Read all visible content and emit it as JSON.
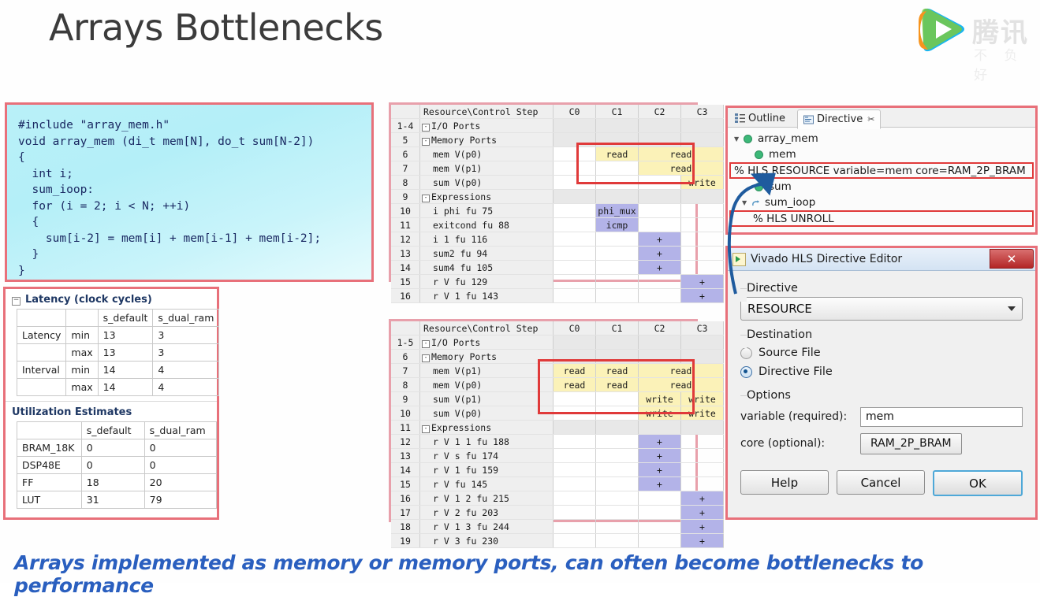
{
  "slide": {
    "title": "Arrays Bottlenecks",
    "caption": "Arrays implemented as memory or memory ports, can often become bottlenecks to performance",
    "logo": {
      "brand": "腾讯",
      "tagline": "不 负 好"
    }
  },
  "code": {
    "text": "#include \"array_mem.h\"\nvoid array_mem (di_t mem[N], do_t sum[N-2])\n{\n  int i;\n  sum_ioop:\n  for (i = 2; i < N; ++i)\n  {\n    sum[i-2] = mem[i] + mem[i-1] + mem[i-2];\n  }\n}"
  },
  "latency": {
    "header": "Latency (clock cycles)",
    "columns": [
      "",
      "",
      "s_default",
      "s_dual_ram"
    ],
    "rows": [
      [
        "Latency",
        "min",
        "13",
        "3"
      ],
      [
        "",
        "max",
        "13",
        "3"
      ],
      [
        "Interval",
        "min",
        "14",
        "4"
      ],
      [
        "",
        "max",
        "14",
        "4"
      ]
    ]
  },
  "utilization": {
    "header": "Utilization Estimates",
    "columns": [
      "",
      "s_default",
      "s_dual_ram"
    ],
    "rows": [
      [
        "BRAM_18K",
        "0",
        "0"
      ],
      [
        "DSP48E",
        "0",
        "0"
      ],
      [
        "FF",
        "18",
        "20"
      ],
      [
        "LUT",
        "31",
        "79"
      ]
    ]
  },
  "schedule1": {
    "header": [
      "",
      "Resource\\Control Step",
      "C0",
      "C1",
      "C2",
      "C3"
    ],
    "rows": [
      {
        "num": "1-4",
        "res": "I/O Ports",
        "group": true,
        "expander": true,
        "cells": [
          "",
          "",
          "",
          ""
        ]
      },
      {
        "num": "5",
        "res": "Memory Ports",
        "group": true,
        "expander": true,
        "cells": [
          "",
          "",
          "",
          ""
        ]
      },
      {
        "num": "6",
        "res": "mem V(p0)",
        "indent": true,
        "cells": [
          "",
          "read",
          "read",
          "read"
        ],
        "fill": [
          "",
          "yel",
          "yel",
          "yel"
        ],
        "span": [
          0,
          0,
          2,
          0
        ]
      },
      {
        "num": "7",
        "res": "mem V(p1)",
        "indent": true,
        "cells": [
          "",
          "",
          "read",
          "read"
        ],
        "fill": [
          "",
          "wht",
          "yel",
          "yel"
        ],
        "span": [
          0,
          0,
          2,
          0
        ]
      },
      {
        "num": "8",
        "res": "sum V(p0)",
        "indent": true,
        "cells": [
          "",
          "",
          "",
          "write"
        ],
        "fill": [
          "",
          "wht",
          "wht",
          "yel"
        ]
      },
      {
        "num": "9",
        "res": "Expressions",
        "group": true,
        "expander": true,
        "cells": [
          "",
          "",
          "",
          ""
        ]
      },
      {
        "num": "10",
        "res": "i phi fu 75",
        "indent": true,
        "cells": [
          "",
          "phi_mux",
          "",
          ""
        ],
        "fill": [
          "",
          "pur",
          "",
          ""
        ]
      },
      {
        "num": "11",
        "res": "exitcond fu 88",
        "indent": true,
        "cells": [
          "",
          "icmp",
          "",
          ""
        ],
        "fill": [
          "",
          "pur",
          "",
          ""
        ]
      },
      {
        "num": "12",
        "res": "i 1 fu 116",
        "indent": true,
        "cells": [
          "",
          "",
          "+",
          ""
        ],
        "fill": [
          "",
          "",
          "pur",
          ""
        ]
      },
      {
        "num": "13",
        "res": "sum2 fu 94",
        "indent": true,
        "cells": [
          "",
          "",
          "+",
          ""
        ],
        "fill": [
          "",
          "",
          "pur",
          ""
        ]
      },
      {
        "num": "14",
        "res": "sum4 fu 105",
        "indent": true,
        "cells": [
          "",
          "",
          "+",
          ""
        ],
        "fill": [
          "",
          "",
          "pur",
          ""
        ]
      },
      {
        "num": "15",
        "res": "r V fu 129",
        "indent": true,
        "cells": [
          "",
          "",
          "",
          "+"
        ],
        "fill": [
          "",
          "",
          "",
          "pur"
        ]
      },
      {
        "num": "16",
        "res": "r V 1 fu 143",
        "indent": true,
        "cells": [
          "",
          "",
          "",
          "+"
        ],
        "fill": [
          "",
          "",
          "",
          "pur"
        ]
      }
    ]
  },
  "schedule2": {
    "header": [
      "",
      "Resource\\Control Step",
      "C0",
      "C1",
      "C2",
      "C3"
    ],
    "rows": [
      {
        "num": "1-5",
        "res": "I/O Ports",
        "group": true,
        "expander": true,
        "cells": [
          "",
          "",
          "",
          ""
        ]
      },
      {
        "num": "6",
        "res": "Memory Ports",
        "group": true,
        "expander": true,
        "cells": [
          "",
          "",
          "",
          ""
        ]
      },
      {
        "num": "7",
        "res": "mem V(p1)",
        "indent": true,
        "cells": [
          "read",
          "read",
          "read",
          "read"
        ],
        "fill": [
          "yel",
          "yel",
          "yel",
          "yel"
        ],
        "span": [
          0,
          0,
          2,
          0
        ]
      },
      {
        "num": "8",
        "res": "mem V(p0)",
        "indent": true,
        "cells": [
          "read",
          "read",
          "read",
          "read"
        ],
        "fill": [
          "yel",
          "yel",
          "yel",
          "yel"
        ],
        "span": [
          0,
          0,
          2,
          0
        ]
      },
      {
        "num": "9",
        "res": "sum V(p1)",
        "indent": true,
        "cells": [
          "",
          "",
          "write",
          "write"
        ],
        "fill": [
          "wht",
          "wht",
          "yel",
          "yel"
        ]
      },
      {
        "num": "10",
        "res": "sum V(p0)",
        "indent": true,
        "cells": [
          "",
          "",
          "write",
          "write"
        ],
        "fill": [
          "wht",
          "wht",
          "yel",
          "yel"
        ]
      },
      {
        "num": "11",
        "res": "Expressions",
        "group": true,
        "expander": true,
        "cells": [
          "",
          "",
          "",
          ""
        ]
      },
      {
        "num": "12",
        "res": "r V 1 1 fu 188",
        "indent": true,
        "cells": [
          "",
          "",
          "+",
          ""
        ],
        "fill": [
          "",
          "",
          "pur",
          ""
        ]
      },
      {
        "num": "13",
        "res": "r V s fu 174",
        "indent": true,
        "cells": [
          "",
          "",
          "+",
          ""
        ],
        "fill": [
          "",
          "",
          "pur",
          ""
        ]
      },
      {
        "num": "14",
        "res": "r V 1 fu 159",
        "indent": true,
        "cells": [
          "",
          "",
          "+",
          ""
        ],
        "fill": [
          "",
          "",
          "pur",
          ""
        ]
      },
      {
        "num": "15",
        "res": "r V fu 145",
        "indent": true,
        "cells": [
          "",
          "",
          "+",
          ""
        ],
        "fill": [
          "",
          "",
          "pur",
          ""
        ]
      },
      {
        "num": "16",
        "res": "r V 1 2 fu 215",
        "indent": true,
        "cells": [
          "",
          "",
          "",
          "+"
        ],
        "fill": [
          "",
          "",
          "",
          "pur"
        ]
      },
      {
        "num": "17",
        "res": "r V 2 fu 203",
        "indent": true,
        "cells": [
          "",
          "",
          "",
          "+"
        ],
        "fill": [
          "",
          "",
          "",
          "pur"
        ]
      },
      {
        "num": "18",
        "res": "r V 1 3 fu 244",
        "indent": true,
        "cells": [
          "",
          "",
          "",
          "+"
        ],
        "fill": [
          "",
          "",
          "",
          "pur"
        ]
      },
      {
        "num": "19",
        "res": "r V 3 fu 230",
        "indent": true,
        "cells": [
          "",
          "",
          "",
          "+"
        ],
        "fill": [
          "",
          "",
          "",
          "pur"
        ]
      }
    ]
  },
  "outline": {
    "tabs": [
      {
        "label": "Outline",
        "active": false,
        "icon": "outline-icon"
      },
      {
        "label": "Directive",
        "active": true,
        "icon": "directive-icon",
        "closable": true
      }
    ],
    "tree": [
      {
        "label": "array_mem",
        "type": "function",
        "indent": 0,
        "expanded": true
      },
      {
        "label": "mem",
        "type": "variable",
        "indent": 1
      },
      {
        "label": "% HLS RESOURCE variable=mem core=RAM_2P_BRAM",
        "type": "directive",
        "indent": 1,
        "highlight": true
      },
      {
        "label": "sum",
        "type": "variable",
        "indent": 1
      },
      {
        "label": "sum_ioop",
        "type": "loop",
        "indent": 1,
        "expanded": true
      },
      {
        "label": "% HLS UNROLL",
        "type": "directive",
        "indent": 2,
        "highlight": true
      }
    ]
  },
  "dialog": {
    "title": "Vivado HLS Directive Editor",
    "close_label": "✕",
    "directive_group": "Directive",
    "directive_value": "RESOURCE",
    "destination_group": "Destination",
    "destination_options": [
      {
        "label": "Source File",
        "selected": false
      },
      {
        "label": "Directive File",
        "selected": true
      }
    ],
    "options_group": "Options",
    "fields": [
      {
        "label": "variable (required):",
        "value": "mem",
        "kind": "text"
      },
      {
        "label": "core (optional):",
        "value": "RAM_2P_BRAM",
        "kind": "button"
      }
    ],
    "buttons": [
      {
        "label": "Help",
        "primary": false
      },
      {
        "label": "Cancel",
        "primary": false
      },
      {
        "label": "OK",
        "primary": true
      }
    ]
  },
  "colors": {
    "callout_red": "#e03a3a",
    "soft_red": "#e8707a",
    "memory_yellow": "#fbf2b8",
    "expression_purple": "#b3b3e8",
    "caption_blue": "#2a5fbf",
    "code_bg": "#b9f0f8"
  }
}
